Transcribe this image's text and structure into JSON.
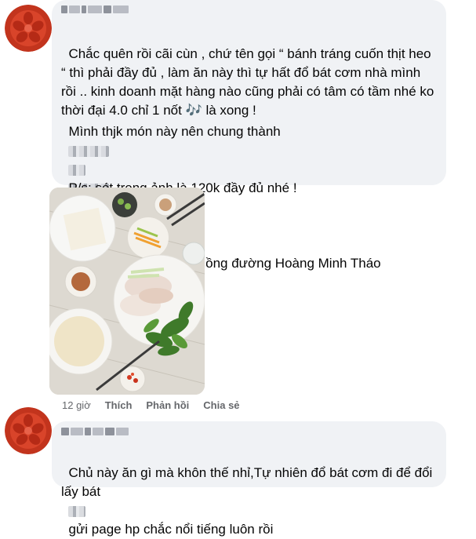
{
  "comment1": {
    "text": "Chắc quên rồi cãi cùn , chứ tên gọi “ bánh tráng cuốn thịt heo “ thì phải đầy đủ , làm ăn này thì tự hất đổ bát cơm nhà mình rồi .. kinh doanh mặt hàng nào cũng phải có tâm có tầm nhé ko thời đại 4.0 chỉ 1 nốt 🎶 là xong !",
    "line2a": "Mình thjk món này nên chung thành",
    "line2b": ") và quán phở chiên phồng đường Hoàng Minh Tháo",
    "ps": "P/s: sét trong ảnh là 120k đầy đủ nhé !",
    "time": "12 giờ",
    "like": "Thích",
    "reply": "Phản hồi",
    "share": "Chia sẻ"
  },
  "comment2": {
    "text_a": "Chủ này ăn gì mà khôn thế nhỉ,Tự nhiên đổ bát cơm đi để đổi lấy bát",
    "text_b": "gửi page hp chắc nổi tiếng luôn rồi"
  },
  "icons": {
    "avatar": "tomato-slice-icon"
  },
  "colors": {
    "bubble": "#f0f2f5",
    "avatar_red": "#c2341d",
    "meta_text": "#65676b"
  }
}
